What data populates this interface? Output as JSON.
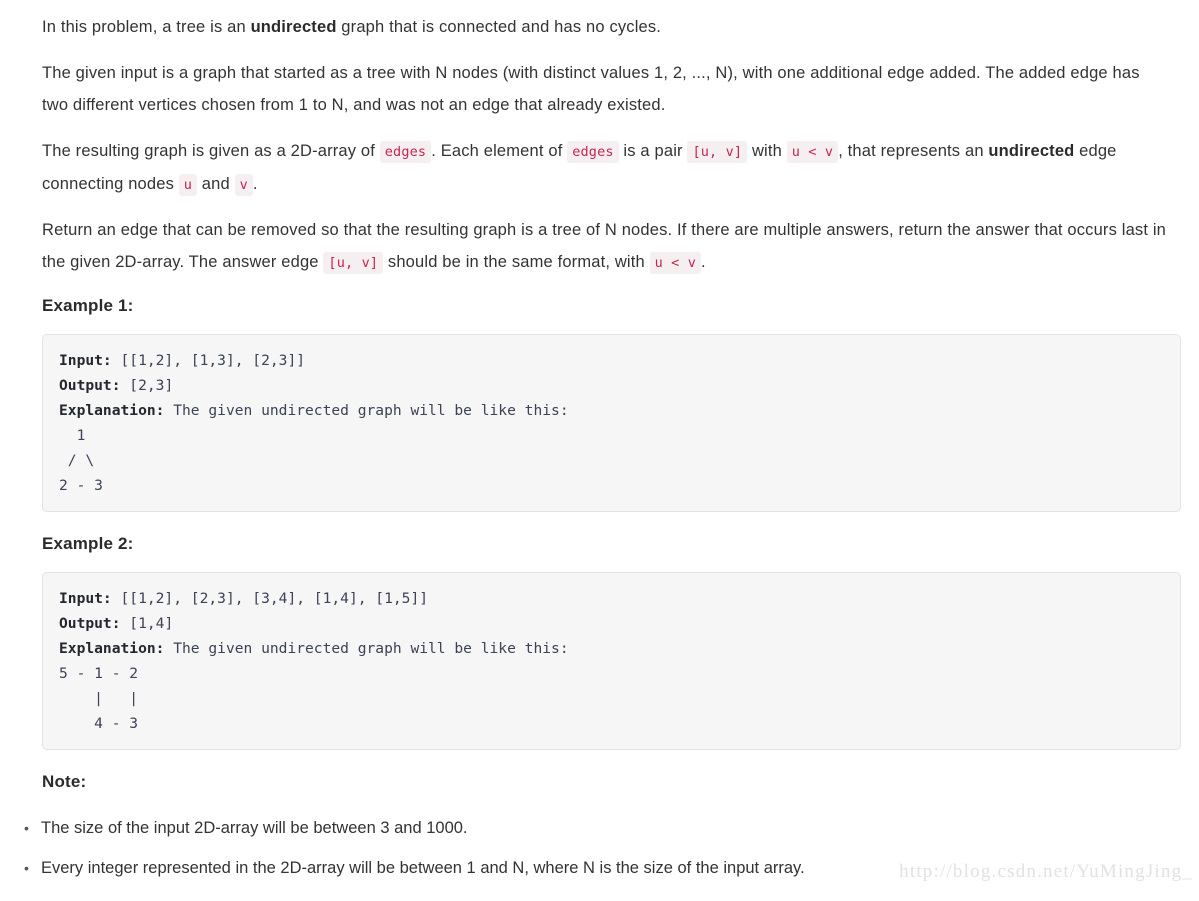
{
  "problem": {
    "paragraph_1": {
      "before_bold": "In this problem, a tree is an ",
      "bold": "undirected",
      "after_bold": " graph that is connected and has no cycles."
    },
    "paragraph_2": "The given input is a graph that started as a tree with N nodes (with distinct values 1, 2, ..., N), with one additional edge added. The added edge has two different vertices chosen from 1 to N, and was not an edge that already existed.",
    "paragraph_3": {
      "seg_1": "The resulting graph is given as a 2D-array of ",
      "code_1": "edges",
      "seg_2": ". Each element of ",
      "code_2": "edges",
      "seg_3": " is a pair ",
      "code_3": "[u, v]",
      "seg_4": " with ",
      "code_4": "u < v",
      "seg_5": ", that represents an ",
      "bold_1": "undirected",
      "seg_6": " edge connecting nodes ",
      "code_5": "u",
      "seg_7": " and ",
      "code_6": "v",
      "seg_8": "."
    },
    "paragraph_4": {
      "seg_1": "Return an edge that can be removed so that the resulting graph is a tree of N nodes. If there are multiple answers, return the answer that occurs last in the given 2D-array. The answer edge ",
      "code_1": "[u, v]",
      "seg_2": " should be in the same format, with ",
      "code_2": "u < v",
      "seg_3": "."
    }
  },
  "examples": [
    {
      "heading": "Example 1:",
      "input_label": "Input:",
      "input_value": " [[1,2], [1,3], [2,3]]",
      "output_label": "Output:",
      "output_value": " [2,3]",
      "explanation_label": "Explanation:",
      "explanation_value": " The given undirected graph will be like this:",
      "ascii_art": "  1\n / \\\n2 - 3"
    },
    {
      "heading": "Example 2:",
      "input_label": "Input:",
      "input_value": " [[1,2], [2,3], [3,4], [1,4], [1,5]]",
      "output_label": "Output:",
      "output_value": " [1,4]",
      "explanation_label": "Explanation:",
      "explanation_value": " The given undirected graph will be like this:",
      "ascii_art": "5 - 1 - 2\n    |   |\n    4 - 3"
    }
  ],
  "note": {
    "heading": "Note:",
    "bullet_glyph": "•",
    "items": [
      "The size of the input 2D-array will be between 3 and 1000.",
      "Every integer represented in the 2D-array will be between 1 and N, where N is the size of the input array."
    ]
  },
  "watermark": "http://blog.csdn.net/YuMingJing_",
  "colors": {
    "text": "#333333",
    "heading": "#2b2b2b",
    "inline_code_text": "#c7254e",
    "inline_code_bg": "#f6eff1",
    "code_block_bg": "#f6f6f6",
    "code_block_border": "#e3e3e3",
    "code_block_text": "#3c4257",
    "watermark": "#e2e2e4"
  }
}
